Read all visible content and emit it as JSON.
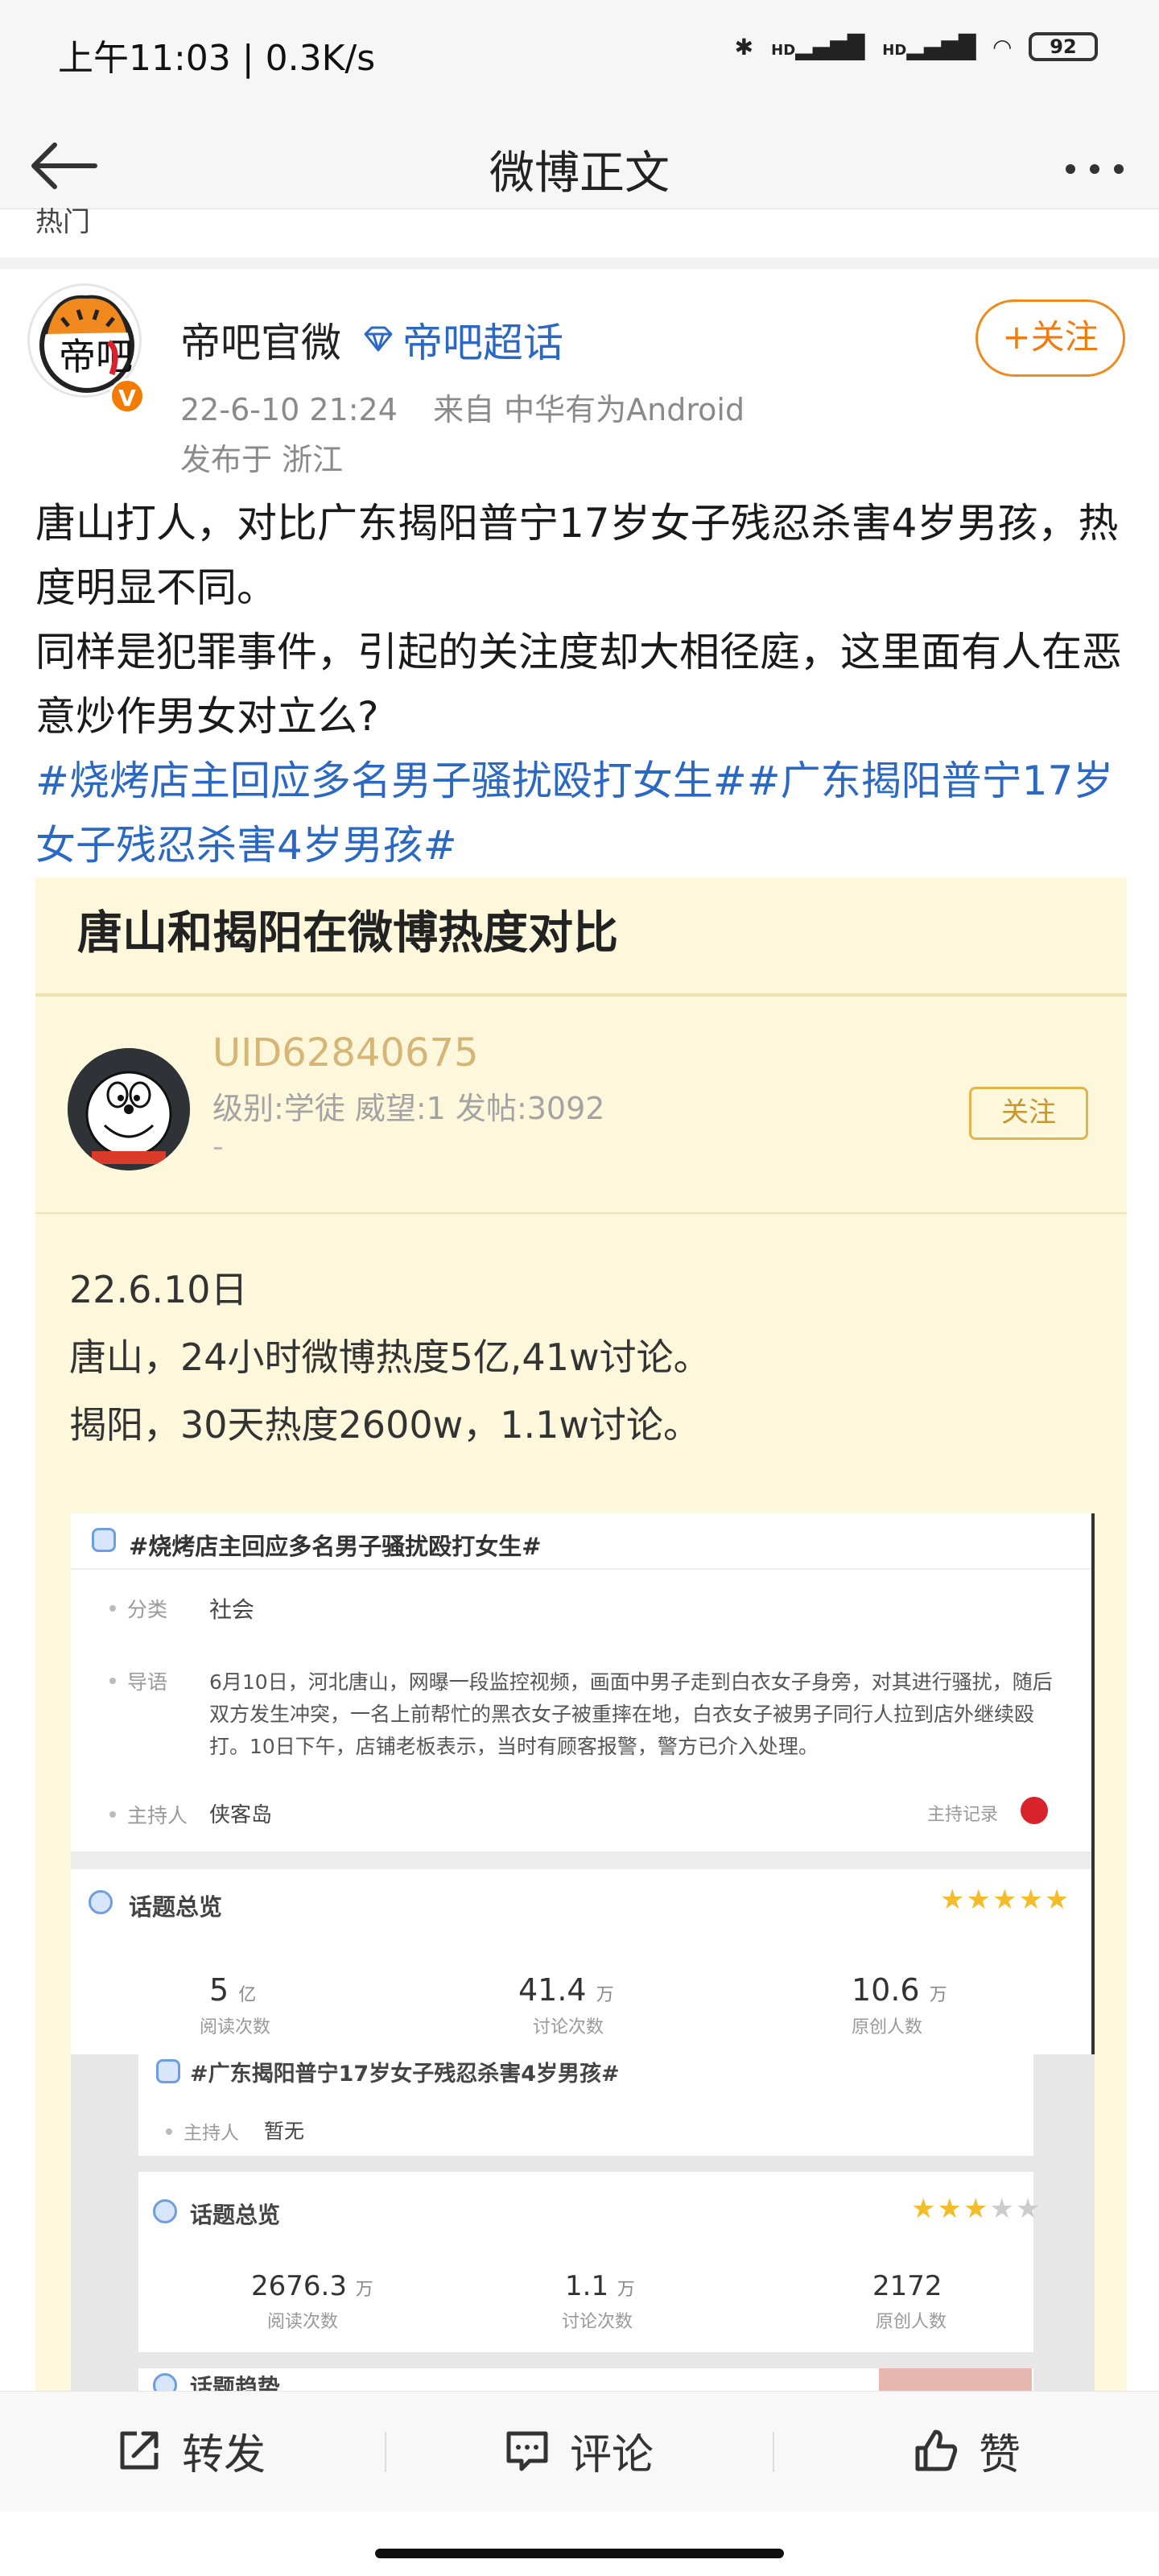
{
  "status_bar": {
    "time_and_speed": "上午11:03 | 0.3K/s",
    "battery": "92",
    "hd1": "HD",
    "hd2": "HD"
  },
  "nav": {
    "title": "微博正文"
  },
  "crumb": "热门",
  "post": {
    "author": "帝吧官微",
    "super_topic": "帝吧超话",
    "follow_label": "+关注",
    "timestamp": "22-6-10 21:24",
    "source": "来自 中华有为Android",
    "location": "发布于 浙江",
    "verified_badge": "V",
    "avatar_text": "帝吧",
    "text_line1": "唐山打人，对比广东揭阳普宁17岁女子残忍杀害4岁男孩，热度明显不同。",
    "text_line2": "同样是犯罪事件，引起的关注度却大相径庭，这里面有人在恶意炒作男女对立么?",
    "topics": "#烧烤店主回应多名男子骚扰殴打女生##广东揭阳普宁17岁女子残忍杀害4岁男孩#"
  },
  "image_card": {
    "title": "唐山和揭阳在微博热度对比",
    "uid": "UID62840675",
    "level": "级别:学徒 威望:1 发帖:3092",
    "dash": "-",
    "follow_label": "关注",
    "date": "22.6.10日",
    "line_tangshan": "唐山，24小时微博热度5亿,41w讨论。",
    "line_jieyang": "揭阳，30天热度2600w，1.1w讨论。",
    "topic1": {
      "title": "#烧烤店主回应多名男子骚扰殴打女生#",
      "category_label": "分类",
      "category": "社会",
      "intro_label": "导语",
      "intro": "6月10日，河北唐山，网曝一段监控视频，画面中男子走到白衣女子身旁，对其进行骚扰，随后双方发生冲突，一名上前帮忙的黑衣女子被重摔在地，白衣女子被男子同行人拉到店外继续殴打。10日下午，店铺老板表示，当时有顾客报警，警方已介入处理。",
      "host_label": "主持人",
      "host": "侠客岛",
      "host_record": "主持记录",
      "overview_label": "话题总览",
      "stars_filled": 5,
      "stats": [
        {
          "value": "5",
          "unit": "亿",
          "label": "阅读次数"
        },
        {
          "value": "41.4",
          "unit": "万",
          "label": "讨论次数"
        },
        {
          "value": "10.6",
          "unit": "万",
          "label": "原创人数"
        }
      ]
    },
    "topic2": {
      "title": "#广东揭阳普宁17岁女子残忍杀害4岁男孩#",
      "host_label": "主持人",
      "host": "暂无",
      "overview_label": "话题总览",
      "stars_filled": 3,
      "stats": [
        {
          "value": "2676.3",
          "unit": "万",
          "label": "阅读次数"
        },
        {
          "value": "1.1",
          "unit": "万",
          "label": "讨论次数"
        },
        {
          "value": "2172",
          "unit": "",
          "label": "原创人数"
        }
      ],
      "trend_label": "话题趋势"
    }
  },
  "bottom_bar": {
    "repost": "转发",
    "comment": "评论",
    "like": "赞"
  },
  "colors": {
    "link_blue": "#2a68c4",
    "follow_orange": "#f07c11",
    "card_bg": "#fdf8dc"
  }
}
